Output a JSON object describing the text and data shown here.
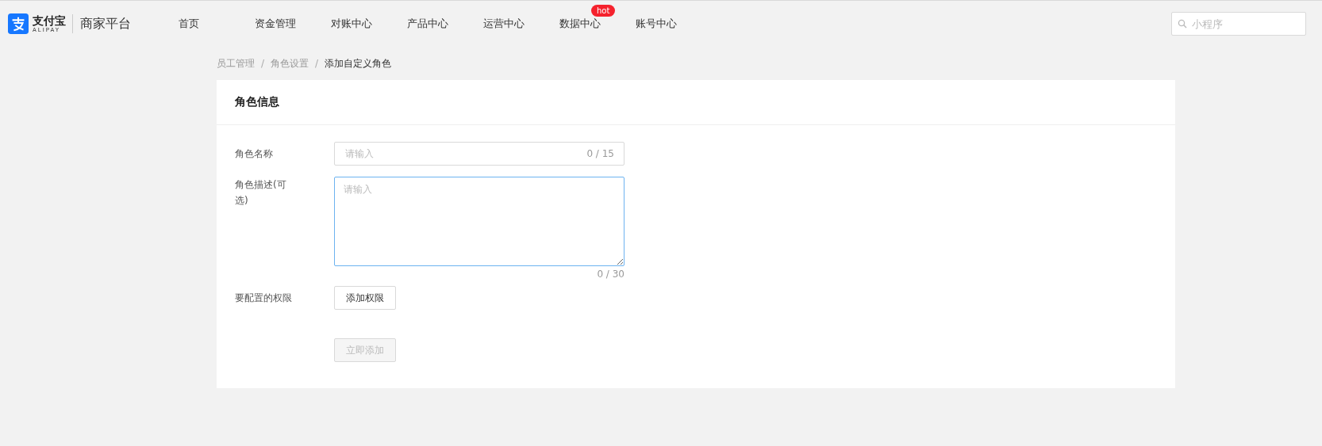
{
  "header": {
    "brand": "支付宝",
    "brand_sub": "ALIPAY",
    "product": "商家平台",
    "nav": [
      {
        "label": "首页"
      },
      {
        "label": "资金管理"
      },
      {
        "label": "对账中心"
      },
      {
        "label": "产品中心"
      },
      {
        "label": "运营中心"
      },
      {
        "label": "数据中心",
        "badge": "hot"
      },
      {
        "label": "账号中心"
      }
    ],
    "search": {
      "placeholder": "小程序"
    }
  },
  "breadcrumb": [
    {
      "label": "员工管理",
      "current": false
    },
    {
      "label": "角色设置",
      "current": false
    },
    {
      "label": "添加自定义角色",
      "current": true
    }
  ],
  "separator": "/",
  "card": {
    "title": "角色信息",
    "fields": [
      {
        "kind": "input",
        "label": "角色名称",
        "placeholder": "请输入",
        "counter": "0 / 15",
        "focused": false
      },
      {
        "kind": "textarea",
        "label": "角色描述(可选)",
        "placeholder": "请输入",
        "counter": "0 / 30",
        "focused": true
      },
      {
        "kind": "button",
        "label": "要配置的权限",
        "button": "添加权限"
      }
    ],
    "submit": {
      "label": "立即添加",
      "disabled": true
    }
  }
}
